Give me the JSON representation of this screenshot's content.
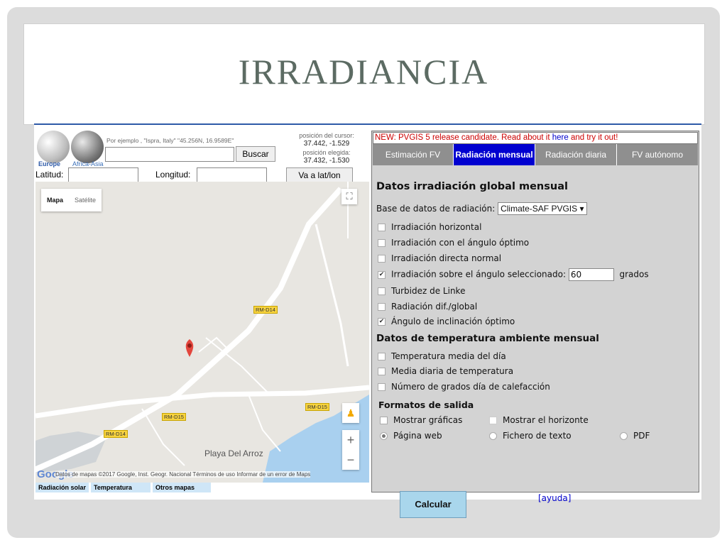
{
  "slide": {
    "title": "IRRADIANCIA"
  },
  "left": {
    "globe_europe": "Europe",
    "globe_africa": "Africa-Asia",
    "example": "Por ejemplo , \"Ispra, Italy\" \"45.256N, 16.9589E\"",
    "search_value": "",
    "search_button": "Buscar",
    "cursor_label": "posición del cursor:",
    "cursor_value": "37.442, -1.529",
    "chosen_label": "posición elegida:",
    "chosen_value": "37.432, -1.530",
    "lat_label": "Latitud:",
    "lon_label": "Longitud:",
    "lat_value": "",
    "lon_value": "",
    "go_button": "Va a lat/lon"
  },
  "map": {
    "type_map": "Mapa",
    "type_satellite": "Satélite",
    "roads": [
      "RM-D14",
      "RM-D15",
      "RM-D15",
      "RM-D14"
    ],
    "place": "Playa Del Arroz",
    "google": "Google",
    "attribution": "Datos de mapas ©2017 Google, Inst. Geogr. Nacional   Términos de uso   Informar de un error de Maps",
    "zoom_in": "+",
    "zoom_out": "−"
  },
  "bottom_tabs": [
    "Radiación solar",
    "Temperatura",
    "Otros mapas"
  ],
  "right": {
    "news_prefix": "NEW: PVGIS 5 release candidate. Read about it ",
    "news_link": "here",
    "news_suffix": " and try it out!",
    "tabs": [
      "Estimación FV",
      "Radiación mensual",
      "Radiación diaria",
      "FV autónomo"
    ],
    "heading1": "Datos irradiación global mensual",
    "db_label": "Base de datos de radiación:",
    "db_value": "Climate-SAF PVGIS",
    "opt1": "Irradiación horizontal",
    "opt2": "Irradiación con el ángulo óptimo",
    "opt3": "Irradiación directa normal",
    "opt4": "Irradiación sobre el ángulo seleccionado:",
    "opt4_value": "60",
    "opt4_unit": "grados",
    "opt5": "Turbidez de Linke",
    "opt6": "Radiación dif./global",
    "opt7": "Ángulo de inclinación óptimo",
    "heading2": "Datos de temperatura ambiente mensual",
    "temp1": "Temperatura media del día",
    "temp2": "Media diaria de temperatura",
    "temp3": "Número de grados día de calefacción",
    "heading3": "Formatos de salida",
    "fmt_graphs": "Mostrar gráficas",
    "fmt_horizon": "Mostrar el horizonte",
    "fmt_web": "Página web",
    "fmt_text": "Fichero de texto",
    "fmt_pdf": "PDF",
    "calc_button": "Calcular",
    "help_link": "[ayuda]"
  }
}
